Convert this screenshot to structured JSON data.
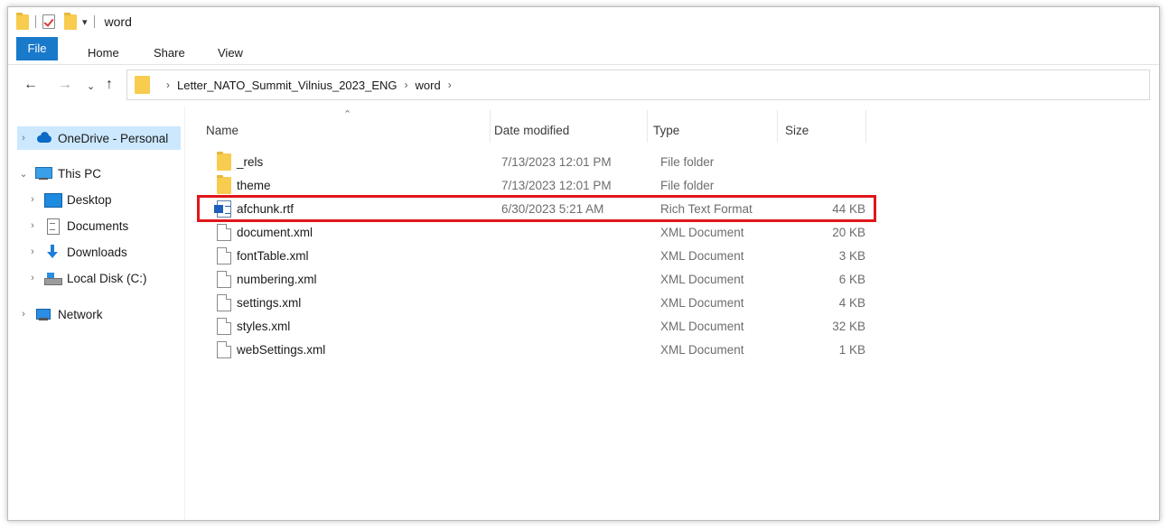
{
  "window": {
    "title": "word"
  },
  "ribbon": {
    "tabs": [
      "File",
      "Home",
      "Share",
      "View"
    ]
  },
  "address": {
    "crumbs": [
      "Letter_NATO_Summit_Vilnius_2023_ENG",
      "word"
    ]
  },
  "nav_pane": {
    "items": [
      {
        "label": "OneDrive - Personal",
        "icon": "cloud-icon"
      },
      {
        "label": "This PC",
        "icon": "computer-icon"
      },
      {
        "label": "Desktop",
        "icon": "desktop-icon"
      },
      {
        "label": "Documents",
        "icon": "documents-icon"
      },
      {
        "label": "Downloads",
        "icon": "downloads-icon"
      },
      {
        "label": "Local Disk (C:)",
        "icon": "disk-icon"
      },
      {
        "label": "Network",
        "icon": "network-icon"
      }
    ]
  },
  "columns": {
    "name": "Name",
    "date": "Date modified",
    "type": "Type",
    "size": "Size"
  },
  "files": [
    {
      "name": "_rels",
      "date": "7/13/2023 12:01 PM",
      "type": "File folder",
      "size": "",
      "icon": "folder-icon"
    },
    {
      "name": "theme",
      "date": "7/13/2023 12:01 PM",
      "type": "File folder",
      "size": "",
      "icon": "folder-icon"
    },
    {
      "name": "afchunk.rtf",
      "date": "6/30/2023 5:21 AM",
      "type": "Rich Text Format",
      "size": "44 KB",
      "icon": "rtf-file-icon"
    },
    {
      "name": "document.xml",
      "date": "",
      "type": "XML Document",
      "size": "20 KB",
      "icon": "file-icon"
    },
    {
      "name": "fontTable.xml",
      "date": "",
      "type": "XML Document",
      "size": "3 KB",
      "icon": "file-icon"
    },
    {
      "name": "numbering.xml",
      "date": "",
      "type": "XML Document",
      "size": "6 KB",
      "icon": "file-icon"
    },
    {
      "name": "settings.xml",
      "date": "",
      "type": "XML Document",
      "size": "4 KB",
      "icon": "file-icon"
    },
    {
      "name": "styles.xml",
      "date": "",
      "type": "XML Document",
      "size": "32 KB",
      "icon": "file-icon"
    },
    {
      "name": "webSettings.xml",
      "date": "",
      "type": "XML Document",
      "size": "1 KB",
      "icon": "file-icon"
    }
  ],
  "colors": {
    "accent": "#1979ca",
    "selected_nav": "#cce8ff",
    "highlight_box": "#e0161b",
    "folder": "#f8cc4f"
  }
}
